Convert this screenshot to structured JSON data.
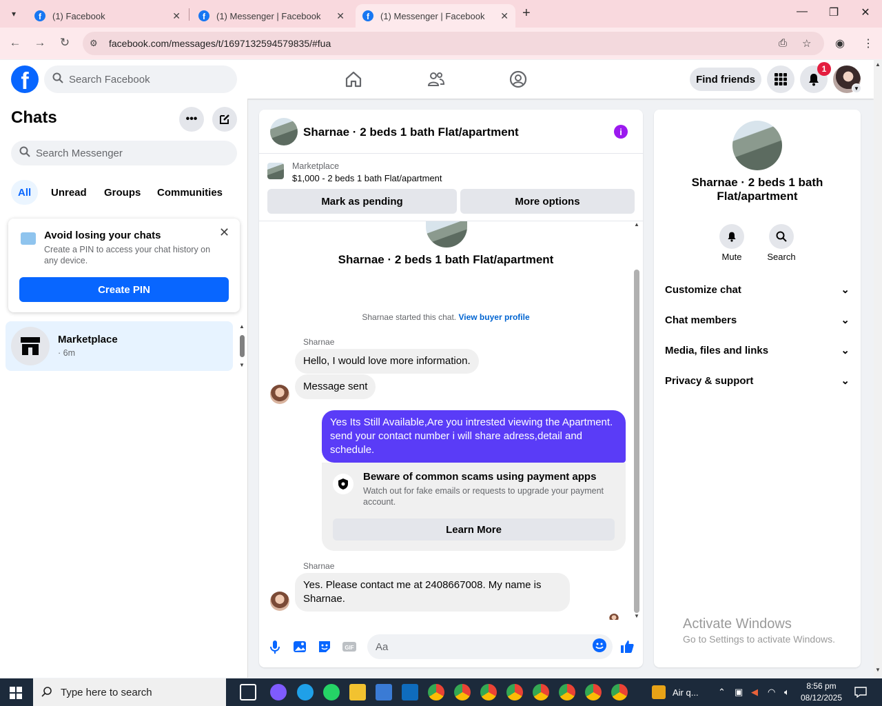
{
  "browser": {
    "tabs": [
      {
        "title": "(1) Facebook",
        "active": false
      },
      {
        "title": "(1) Messenger | Facebook",
        "active": false
      },
      {
        "title": "(1) Messenger | Facebook",
        "active": true
      }
    ],
    "url": "facebook.com/messages/t/1697132594579835/#fua"
  },
  "fb_header": {
    "search_placeholder": "Search Facebook",
    "find_friends": "Find friends",
    "notification_count": "1"
  },
  "sidebar": {
    "title": "Chats",
    "search_placeholder": "Search Messenger",
    "filters": [
      "All",
      "Unread",
      "Groups",
      "Communities"
    ],
    "pin_card": {
      "title": "Avoid losing your chats",
      "subtitle": "Create a PIN to access your chat history on any device.",
      "button": "Create PIN"
    },
    "chats": [
      {
        "name": "Marketplace",
        "time": "· 6m"
      }
    ]
  },
  "conversation": {
    "name": "Sharnae · 2 beds 1 bath Flat/apartment",
    "marketplace_label": "Marketplace",
    "listing": "$1,000 - 2 beds 1 bath Flat/apartment",
    "mark_pending": "Mark as pending",
    "more_options": "More options",
    "started_text": "Sharnae started this chat.",
    "buyer_profile_link": "View buyer profile",
    "messages": [
      {
        "sender": "Sharnae",
        "text": "Hello, I would love more information."
      },
      {
        "sender": "",
        "text": "Message sent"
      },
      {
        "sender": "me",
        "text": "Yes Its Still Available,Are you intrested viewing the Apartment. send your contact number i will share adress,detail and schedule."
      },
      {
        "sender": "Sharnae",
        "text": "Yes. Please contact me at 2408667008. My name is Sharnae."
      }
    ],
    "warning": {
      "title": "Beware of common scams using payment apps",
      "text": "Watch out for fake emails or requests to upgrade your payment account.",
      "button": "Learn More"
    },
    "composer_placeholder": "Aa"
  },
  "details": {
    "name": "Sharnae · 2 beds 1 bath Flat/apartment",
    "actions": [
      "Mute",
      "Search"
    ],
    "sections": [
      "Customize chat",
      "Chat members",
      "Media, files and links",
      "Privacy & support"
    ]
  },
  "watermark": {
    "line1": "Activate Windows",
    "line2": "Go to Settings to activate Windows."
  },
  "taskbar": {
    "search_placeholder": "Type here to search",
    "weather": "Air q...",
    "time": "8:56 pm",
    "date": "08/12/2025"
  },
  "colors": {
    "fb_blue": "#0866ff",
    "my_bubble": "#5a3cf7",
    "info_purple": "#9b19ef",
    "badge_red": "#e41e3f"
  }
}
